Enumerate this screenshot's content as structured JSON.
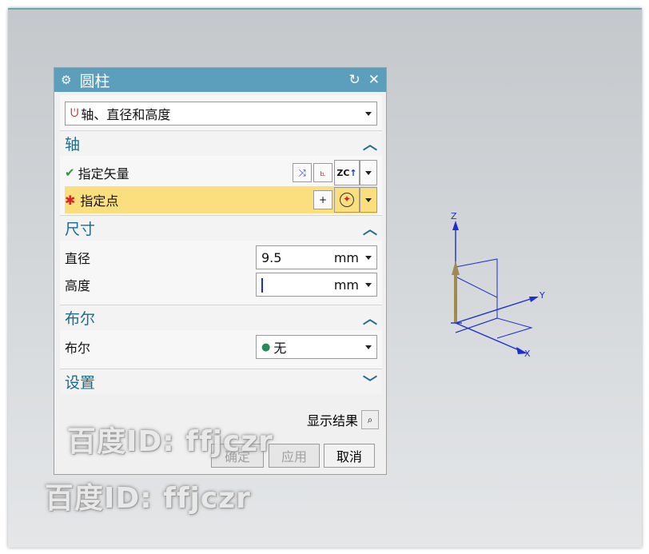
{
  "dialog": {
    "title": "圆柱",
    "type_select": {
      "value": "轴、直径和高度"
    },
    "sections": {
      "axis": {
        "header": "轴",
        "vector_label": "指定矢量",
        "point_label": "指定点",
        "vector_button_text": "ZC"
      },
      "dimensions": {
        "header": "尺寸",
        "diameter_label": "直径",
        "diameter_value": "9.5",
        "diameter_unit": "mm",
        "height_label": "高度",
        "height_value": "",
        "height_unit": "mm"
      },
      "boolean": {
        "header": "布尔",
        "label": "布尔",
        "value": "无"
      },
      "settings": {
        "header": "设置"
      }
    },
    "footer": {
      "show_result": "显示结果",
      "ok": "确定",
      "apply": "应用",
      "cancel": "取消"
    }
  },
  "viewport": {
    "axis_labels": {
      "z": "Z",
      "y": "Y",
      "x": "X"
    }
  },
  "watermarks": [
    "百度ID: ffjczr",
    "百度ID: ffjczr"
  ],
  "colors": {
    "title_bar": "#5c9fbd",
    "section_header": "#1b6b8c",
    "highlight_row": "#fbdf7f",
    "axis_blue": "#1c2fd0",
    "axis_tan": "#a08a50"
  }
}
